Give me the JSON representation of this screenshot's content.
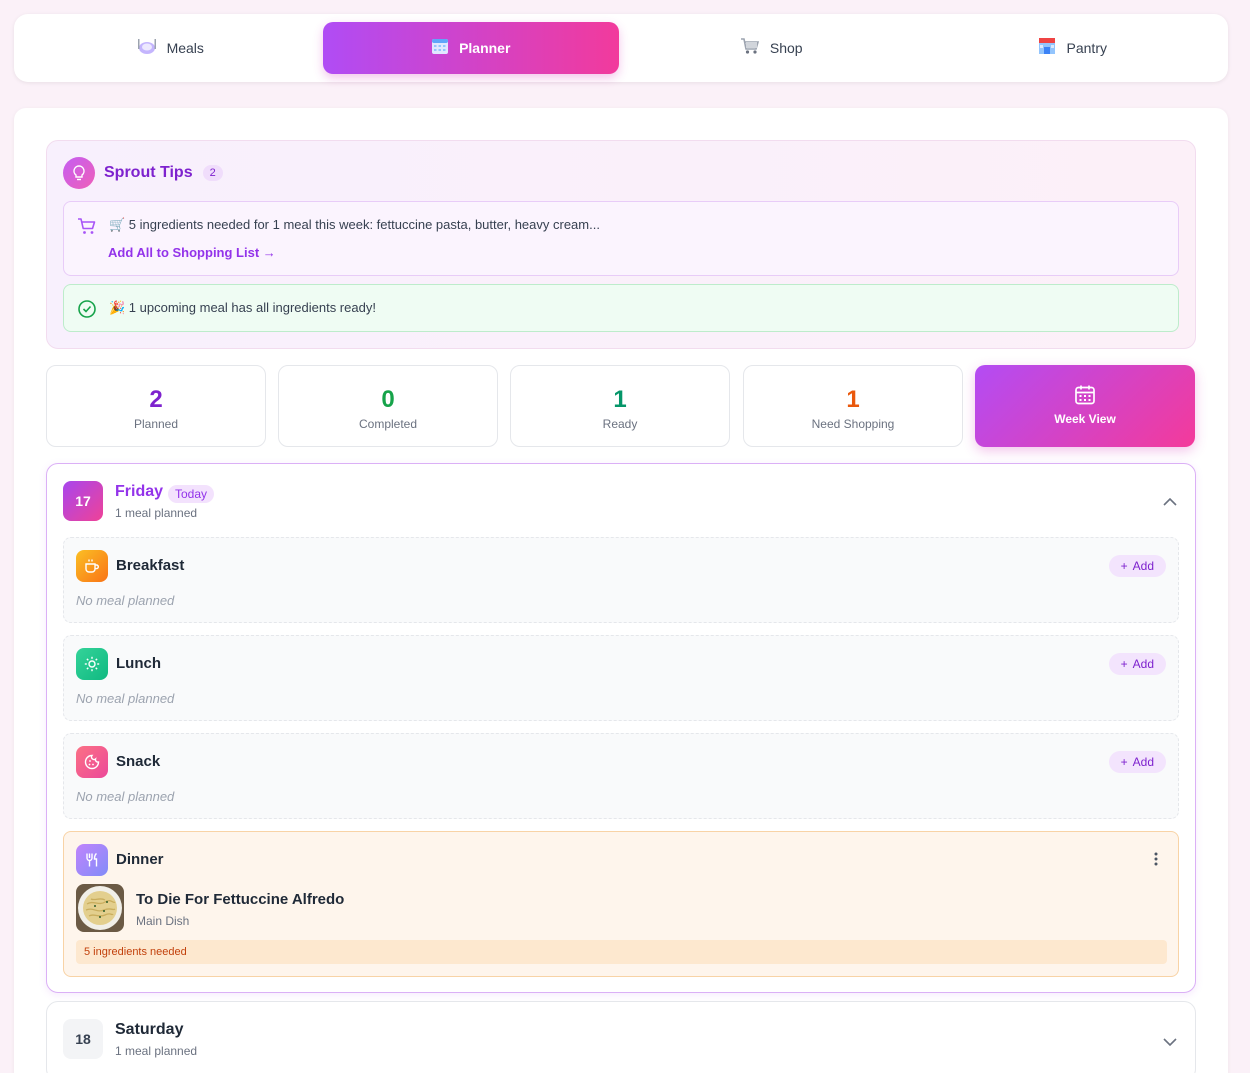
{
  "nav": {
    "tabs": [
      {
        "label": "Meals",
        "icon": "plate-icon",
        "active": false
      },
      {
        "label": "Planner",
        "icon": "calendar-icon",
        "active": true
      },
      {
        "label": "Shop",
        "icon": "cart-icon",
        "active": false
      },
      {
        "label": "Pantry",
        "icon": "store-icon",
        "active": false
      }
    ]
  },
  "tips": {
    "title": "Sprout Tips",
    "count": "2",
    "shopping": {
      "text": "🛒 5 ingredients needed for 1 meal this week: fettuccine pasta, butter, heavy cream...",
      "link": "Add All to Shopping List →"
    },
    "ready": {
      "text": "🎉 1 upcoming meal has all ingredients ready!"
    }
  },
  "stats": {
    "planned": {
      "value": "2",
      "label": "Planned",
      "color": "#7e22ce"
    },
    "completed": {
      "value": "0",
      "label": "Completed",
      "color": "#16a34a"
    },
    "ready": {
      "value": "1",
      "label": "Ready",
      "color": "#059669"
    },
    "need_shopping": {
      "value": "1",
      "label": "Need Shopping",
      "color": "#ea580c"
    },
    "week_view_label": "Week View"
  },
  "days": [
    {
      "number": "17",
      "name": "Friday",
      "today_label": "Today",
      "summary": "1 meal planned",
      "slots": [
        {
          "title": "Breakfast",
          "empty_text": "No meal planned",
          "add_label": "Add"
        },
        {
          "title": "Lunch",
          "empty_text": "No meal planned",
          "add_label": "Add"
        },
        {
          "title": "Snack",
          "empty_text": "No meal planned",
          "add_label": "Add"
        }
      ],
      "dinner": {
        "title": "Dinner",
        "recipe": "To Die For Fettuccine Alfredo",
        "category": "Main Dish",
        "ingredients_needed": "5 ingredients needed"
      }
    },
    {
      "number": "18",
      "name": "Saturday",
      "summary": "1 meal planned"
    }
  ],
  "colors": {
    "accent_start": "#b04cf5",
    "accent_end": "#f23a9c",
    "breakfast": "#f59e0b",
    "lunch": "#10b981",
    "snack": "#f472b6",
    "dinner": "#a78bfa"
  }
}
